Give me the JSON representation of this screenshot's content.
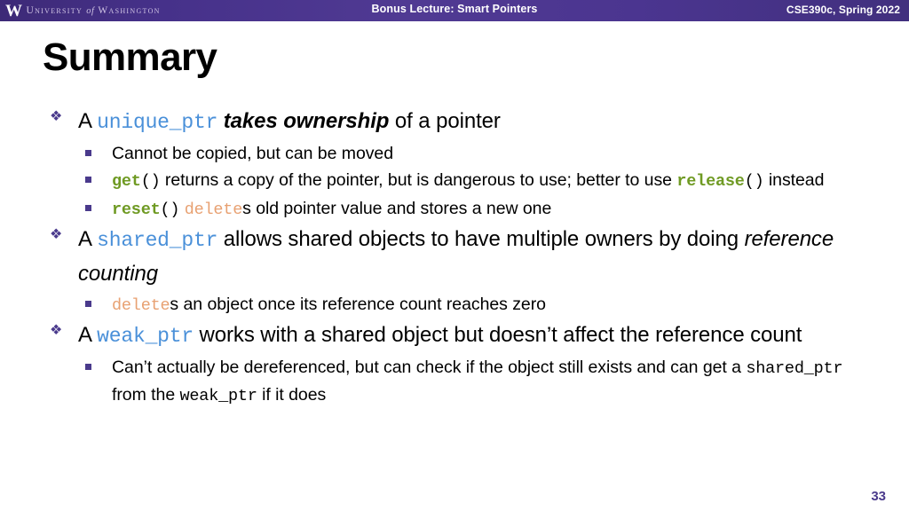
{
  "header": {
    "logo_w": "W",
    "logo_words_pre": "University",
    "logo_words_of": "of",
    "logo_words_post": "Washington",
    "center_title": "Bonus Lecture: Smart Pointers",
    "right_title": "CSE390c, Spring 2022",
    "bar_color": "#4b3590"
  },
  "slide": {
    "title": "Summary",
    "page_number": "33"
  },
  "colors": {
    "accent_purple": "#4a3a8c",
    "code_blue": "#4a90d9",
    "code_green": "#6f9a23",
    "code_orange": "#e8a172"
  },
  "bullets": {
    "b1": {
      "t1": "A ",
      "code1": "unique_ptr",
      "t2": " ",
      "em1": "takes ownership",
      "t3": " of a pointer"
    },
    "b1s1": {
      "t1": "Cannot be copied, but can be moved"
    },
    "b1s2": {
      "code1": "get",
      "code1paren": "()",
      "t1": " returns a copy of the pointer, but is dangerous to use; better to use ",
      "code2": "release",
      "code2paren": "()",
      "t2": " instead"
    },
    "b1s3": {
      "code1": "reset",
      "code1paren": "()",
      "t1": " ",
      "code2": "delete",
      "t2": "s old pointer value and stores a new one"
    },
    "b2": {
      "t1": "A ",
      "code1": "shared_ptr",
      "t2": " allows shared objects to have multiple owners by doing ",
      "em1": "reference counting"
    },
    "b2s1": {
      "code1": "delete",
      "t1": "s an object once its reference count reaches zero"
    },
    "b3": {
      "t1": "A ",
      "code1": "weak_ptr",
      "t2": " works with a shared object but doesn’t affect the reference count"
    },
    "b3s1": {
      "t1": "Can’t actually be dereferenced, but can check if the object still exists and can get a ",
      "code1": "shared_ptr",
      "t2": " from the ",
      "code2": "weak_ptr",
      "t3": " if it does"
    }
  }
}
